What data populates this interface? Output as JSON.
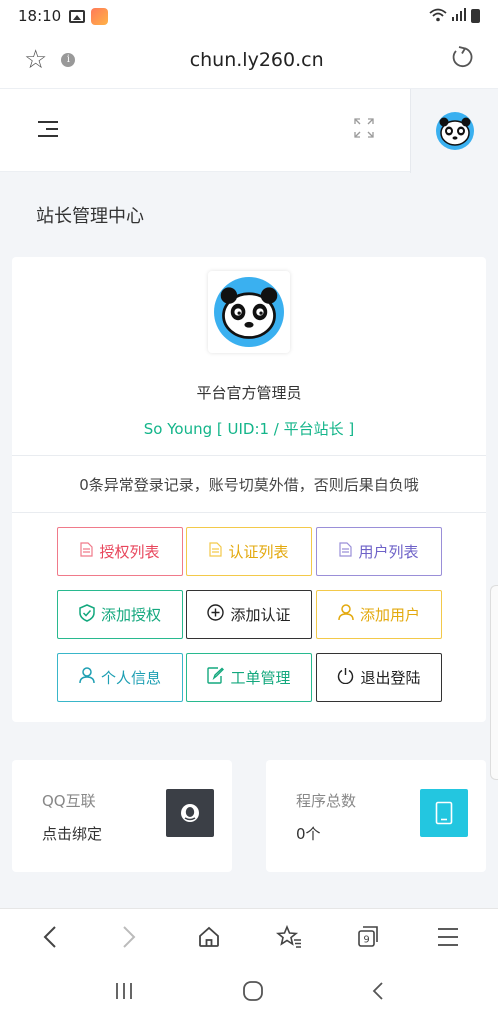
{
  "status": {
    "time": "18:10"
  },
  "browser": {
    "url": "chun.ly260.cn"
  },
  "page": {
    "title": "站长管理中心"
  },
  "profile": {
    "role": "平台官方管理员",
    "uid_line": "So Young [ UID:1 / 平台站长 ]",
    "notice": "0条异常登录记录，账号切莫外借，否则后果自负哦"
  },
  "buttons": {
    "auth_list": "授权列表",
    "cert_list": "认证列表",
    "user_list": "用户列表",
    "add_auth": "添加授权",
    "add_cert": "添加认证",
    "add_user": "添加用户",
    "personal_info": "个人信息",
    "ticket_mgmt": "工单管理",
    "logout": "退出登陆"
  },
  "stats": {
    "qq": {
      "title": "QQ互联",
      "value": "点击绑定",
      "color": "#3b3f46"
    },
    "programs": {
      "title": "程序总数",
      "value": "0个",
      "color": "#23c6e0"
    }
  },
  "colors": {
    "accent_green": "#14b58a",
    "avatar_bg": "#3ab0f0"
  }
}
